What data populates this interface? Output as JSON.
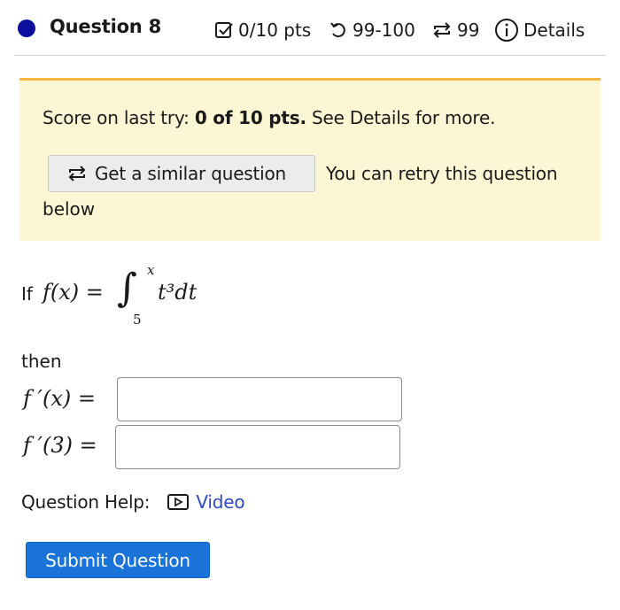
{
  "header": {
    "title": "Question 8",
    "points": "0/10 pts",
    "attempts": "99-100",
    "retries": "99",
    "details": "Details"
  },
  "banner": {
    "score_prefix": "Score on last try: ",
    "score_value": "0 of 10 pts.",
    "score_suffix": " See Details for more.",
    "similar_button": "Get a similar question",
    "retry_text": "You can retry this question",
    "retry_below": "below"
  },
  "problem": {
    "if_word": "If",
    "function_lhs": "f(x) =",
    "upper_limit": "x",
    "lower_limit": "5",
    "integrand": "t³dt",
    "then_word": "then",
    "eq1_label": "f ′(x) =",
    "eq2_label": "f ′(3) =",
    "eq1_value": "",
    "eq2_value": ""
  },
  "help": {
    "label": "Question Help:",
    "video": "Video"
  },
  "submit_label": "Submit Question",
  "colors": {
    "accent_blue": "#1a73d9",
    "banner_bg": "#fdf6d4",
    "banner_border": "#f5b443",
    "dot": "#0d0d9e",
    "link": "#2f48c2"
  }
}
